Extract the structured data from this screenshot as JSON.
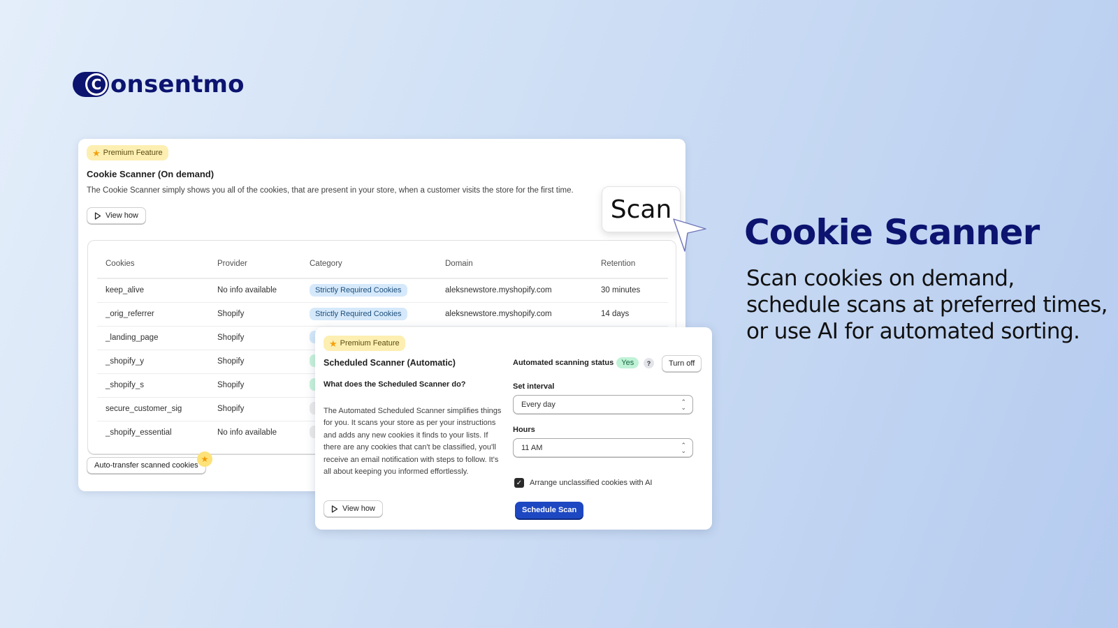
{
  "brand": {
    "logo_letter": "C",
    "logo_text": "onsentmo",
    "color": "#0c1470"
  },
  "main_card": {
    "badge": "Premium Feature",
    "title": "Cookie Scanner (On demand)",
    "description": "The Cookie Scanner simply shows you all of the cookies, that are present in your store, when a customer visits the store for the first time.",
    "view_how_label": "View how",
    "scan_label": "Scan",
    "auto_transfer_label": "Auto-transfer scanned cookies",
    "table": {
      "columns": [
        "Cookies",
        "Provider",
        "Category",
        "Domain",
        "Retention"
      ],
      "rows": [
        {
          "cookie": "keep_alive",
          "provider": "No info available",
          "category": "Strictly Required Cookies",
          "category_color": "blue",
          "domain": "aleksnewstore.myshopify.com",
          "retention": "30 minutes"
        },
        {
          "cookie": "_orig_referrer",
          "provider": "Shopify",
          "category": "Strictly Required Cookies",
          "category_color": "blue",
          "domain": "aleksnewstore.myshopify.com",
          "retention": "14 days"
        },
        {
          "cookie": "_landing_page",
          "provider": "Shopify",
          "category": "",
          "category_color": "blue",
          "domain": "",
          "retention": ""
        },
        {
          "cookie": "_shopify_y",
          "provider": "Shopify",
          "category": "",
          "category_color": "green",
          "domain": "",
          "retention": ""
        },
        {
          "cookie": "_shopify_s",
          "provider": "Shopify",
          "category": "",
          "category_color": "green",
          "domain": "",
          "retention": ""
        },
        {
          "cookie": "secure_customer_sig",
          "provider": "Shopify",
          "category": "",
          "category_color": "gray",
          "domain": "",
          "retention": ""
        },
        {
          "cookie": "_shopify_essential",
          "provider": "No info available",
          "category": "",
          "category_color": "gray",
          "domain": "",
          "retention": ""
        }
      ]
    }
  },
  "schedule_card": {
    "badge": "Premium Feature",
    "title": "Scheduled Scanner (Automatic)",
    "question": "What does the Scheduled Scanner do?",
    "paragraph": "The Automated Scheduled Scanner simplifies things for you. It scans your store as per your instructions and adds any new cookies it finds to your lists. If there are any cookies that can't be classified, you'll receive an email notification with steps to follow. It's all about keeping you informed effortlessly.",
    "view_how_label": "View how",
    "status_label": "Automated scanning status",
    "status_value": "Yes",
    "help_label": "?",
    "turn_off_label": "Turn off",
    "interval_label": "Set interval",
    "interval_value": "Every day",
    "hours_label": "Hours",
    "hours_value": "11 AM",
    "ai_checkbox_label": "Arrange unclassified cookies with AI",
    "ai_checkbox_checked": true,
    "schedule_button_label": "Schedule Scan"
  },
  "hero": {
    "title": "Cookie Scanner",
    "subtitle": "Scan cookies on demand, schedule scans at preferred times, or use AI for automated sorting."
  }
}
